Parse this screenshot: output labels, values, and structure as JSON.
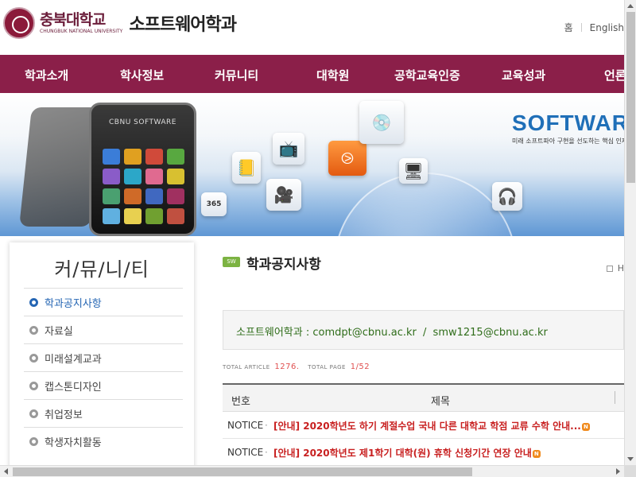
{
  "header": {
    "univ_name": "충북대학교",
    "univ_name_en": "CHUNGBUK NATIONAL UNIVERSITY",
    "dept_name": "소프트웨어학과",
    "util_links": [
      "홈",
      "English"
    ]
  },
  "gnb": {
    "items": [
      "학과소개",
      "학사정보",
      "커뮤니티",
      "대학원",
      "공학교육인증",
      "교육성과",
      "언론"
    ]
  },
  "banner": {
    "phone_label": "CBNU SOFTWARE",
    "logo_text": "SOFTWAR",
    "slogan": "미래 소프트파아 구현을 선도하는 핵심 인재",
    "tile_365": "365"
  },
  "sidebar": {
    "title": "커/뮤/니/티",
    "items": [
      {
        "label": "학과공지사항",
        "active": true
      },
      {
        "label": "자료실",
        "active": false
      },
      {
        "label": "미래설계교과",
        "active": false
      },
      {
        "label": "캡스톤디자인",
        "active": false
      },
      {
        "label": "취업정보",
        "active": false
      },
      {
        "label": "학생자치활동",
        "active": false
      }
    ]
  },
  "content": {
    "badge": "SW",
    "title": "학과공지사항",
    "home_path": "H",
    "contact_label": "소프트웨어학과 :",
    "email1": "comdpt@cbnu.ac.kr",
    "email_sep": "/",
    "email2": "smw1215@cbnu.ac.kr",
    "stats": {
      "total_article_label": "TOTAL ARTICLE",
      "total_article": "1276.",
      "total_page_label": "TOTAL PAGE",
      "total_page": "1/52"
    },
    "table": {
      "headers": [
        "번호",
        "제목"
      ],
      "rows": [
        {
          "no": "NOTICE",
          "title": "[안내] 2020학년도 하기 계절수업 국내 다른 대학교 학점 교류 수학 안내...",
          "new": "N"
        },
        {
          "no": "NOTICE",
          "title": "[안내] 2020학년도 제1학기 대학(원) 휴학 신청기간 연장 안내",
          "new": "N"
        }
      ]
    }
  },
  "colors": {
    "nav_bg": "#8b1f49",
    "active": "#2465b3",
    "notice_title": "#c82020"
  }
}
